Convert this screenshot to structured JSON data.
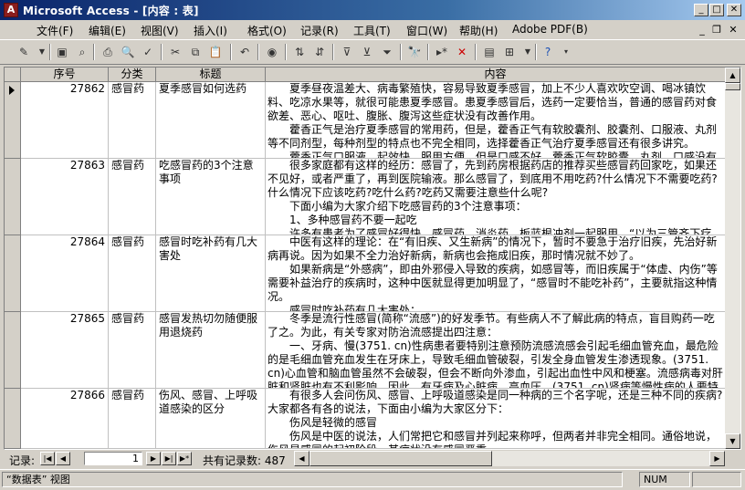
{
  "window": {
    "title": "Microsoft Access - [内容 : 表]",
    "app_icon": "key-icon"
  },
  "menu": [
    "文件(F)",
    "编辑(E)",
    "视图(V)",
    "插入(I)",
    "格式(O)",
    "记录(R)",
    "工具(T)",
    "窗口(W)",
    "帮助(H)",
    "Adobe PDF(B)"
  ],
  "columns": {
    "id": "序号",
    "category": "分类",
    "title": "标题",
    "content": "内容"
  },
  "rows": [
    {
      "id": "27862",
      "category": "感冒药",
      "title": "夏季感冒如何选药",
      "content": "　　夏季昼夜温差大、病毒繁殖快，容易导致夏季感冒，加上不少人喜欢吹空调、喝冰镇饮料、吃凉水果等，就很可能患夏季感冒。患夏季感冒后，选药一定要恰当，普通的感冒药对食欲差、恶心、呕吐、腹胀、腹泻这些症状没有改善作用。\n　　藿香正气是治疗夏季感冒的常用药，但是，藿香正气有软胶囊剂、胶囊剂、口服液、丸剂等不同剂型，每种剂型的特点也不完全相同，选择藿香正气治疗夏季感冒还有很多讲究。\n　　藿香正气口服液，起效快、服用方便，但是口感不好。藿香正气软胶囊、丸剂，口感没有苦"
    },
    {
      "id": "27863",
      "category": "感冒药",
      "title": "吃感冒药的3个注意事项",
      "content": "　　很多家庭都有这样的经历：感冒了，先到药房根据药店的推荐买些感冒药回家吃，如果还不见好，或者严重了，再到医院输液。那么感冒了，到底用不用吃药?什么情况下不需要吃药?什么情况下应该吃药?吃什么药?吃药又需要注意些什么呢?\n　　下面小编为大家介绍下吃感冒药的3个注意事项：\n　　1、多种感冒药不要一起吃\n　　许多有患者为了感冒好得快，感冒药、消炎药、板蓝根冲剂一起服用，“以为三管齐下疗"
    },
    {
      "id": "27864",
      "category": "感冒药",
      "title": "感冒时吃补药有几大害处",
      "content": "　　中医有这样的理论：在“有旧疾、又生新病”的情况下，暂时不要急于治疗旧疾，先治好新病再说。因为如果不全力治好新病，新病也会拖成旧疾，那时情况就不妙了。\n　　如果新病是“外感病”，即由外邪侵入导致的疾病，如感冒等，而旧疾属于“体虚、内伤”等需要补益治疗的疾病时，这种中医就显得更加明显了，“感冒时不能吃补药”，主要就指这种情况。\n　　感冒时吃补药有几大害处："
    },
    {
      "id": "27865",
      "category": "感冒药",
      "title": "感冒发热切勿随便服用退烧药",
      "content": "　　冬季是流行性感冒(简称“流感”)的好发季节。有些病人不了解此病的特点，盲目购药一吃了之。为此，有关专家对防治流感提出四注意：\n　　一、牙病、慢(3751. cn)性病患者要特别注意预防流感流感会引起毛细血管充血，最危险的是毛细血管充血发生在牙床上，导致毛细血管破裂，引发全身血管发生渗透现象。(3751. cn)心血管和脑血管虽然不会破裂，但会不断向外渗血，引起出血性中风和梗塞。流感病毒对肝脏和肾脏也有不利影响。因此，有牙病及心脏病、高血压、(3751. cn)肾病等慢性病的人要特别注意"
    },
    {
      "id": "27866",
      "category": "感冒药",
      "title": "伤风、感冒、上呼吸道感染的区分",
      "content": "　　有很多人会问伤风、感冒、上呼吸道感染是同一种病的三个名字呢，还是三种不同的疾病?大家都各有各的说法，下面由小编为大家区分下：\n　　伤风是轻微的感冒\n　　伤风是中医的说法，人们常把它和感冒并列起来称呼，但两者并非完全相同。通俗地说，伤风是感冒的起初阶段，其症状没有感冒严重。"
    }
  ],
  "navigator": {
    "label": "记录:",
    "current": "1",
    "total_text": "共有记录数: 487"
  },
  "status": {
    "view": "“数据表” 视图",
    "num": "NUM"
  }
}
